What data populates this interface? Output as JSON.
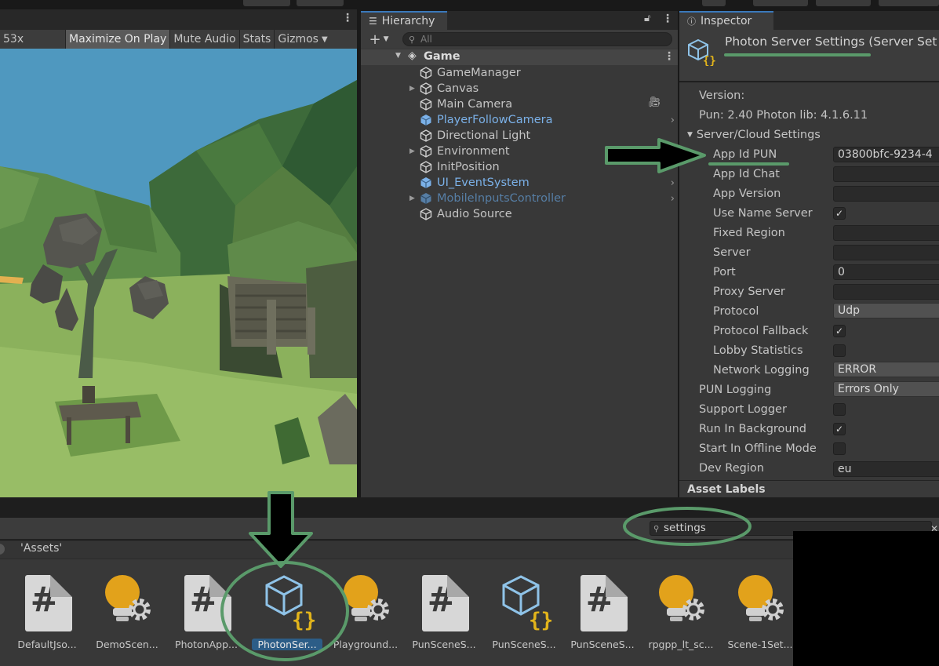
{
  "game_view": {
    "scale_label": "53x",
    "toolbar": [
      {
        "label": "Maximize On Play",
        "active": true
      },
      {
        "label": "Mute Audio",
        "active": false
      },
      {
        "label": "Stats",
        "active": false
      },
      {
        "label": "Gizmos",
        "active": false
      }
    ]
  },
  "hierarchy": {
    "tab_label": "Hierarchy",
    "search_placeholder": "All",
    "scene_name": "Game",
    "items": [
      {
        "label": "GameManager",
        "foldout": false,
        "prefab": "none"
      },
      {
        "label": "Canvas",
        "foldout": true,
        "prefab": "none"
      },
      {
        "label": "Main Camera",
        "foldout": false,
        "prefab": "none"
      },
      {
        "label": "PlayerFollowCamera",
        "foldout": false,
        "prefab": "prefab"
      },
      {
        "label": "Directional Light",
        "foldout": false,
        "prefab": "none"
      },
      {
        "label": "Environment",
        "foldout": true,
        "prefab": "none"
      },
      {
        "label": "InitPosition",
        "foldout": false,
        "prefab": "none"
      },
      {
        "label": "UI_EventSystem",
        "foldout": false,
        "prefab": "prefab"
      },
      {
        "label": "MobileInputsController",
        "foldout": true,
        "prefab": "prefab-disabled"
      },
      {
        "label": "Audio Source",
        "foldout": false,
        "prefab": "none"
      }
    ]
  },
  "inspector": {
    "tab_label": "Inspector",
    "title": "Photon Server Settings (Server Set",
    "version_label": "Version:",
    "version_value": "Pun: 2.40 Photon lib: 4.1.6.11",
    "section_label": "Server/Cloud Settings",
    "server_fields": [
      {
        "label": "App Id PUN",
        "type": "text",
        "value": "03800bfc-9234-4"
      },
      {
        "label": "App Id Chat",
        "type": "text",
        "value": ""
      },
      {
        "label": "App Version",
        "type": "text",
        "value": ""
      },
      {
        "label": "Use Name Server",
        "type": "check",
        "value": "✓"
      },
      {
        "label": "Fixed Region",
        "type": "text",
        "value": ""
      },
      {
        "label": "Server",
        "type": "text",
        "value": ""
      },
      {
        "label": "Port",
        "type": "text",
        "value": "0"
      },
      {
        "label": "Proxy Server",
        "type": "text",
        "value": ""
      },
      {
        "label": "Protocol",
        "type": "dropdown",
        "value": "Udp"
      },
      {
        "label": "Protocol Fallback",
        "type": "check",
        "value": "✓"
      },
      {
        "label": "Lobby Statistics",
        "type": "check",
        "value": ""
      },
      {
        "label": "Network Logging",
        "type": "dropdown",
        "value": "ERROR"
      }
    ],
    "general_fields": [
      {
        "label": "PUN Logging",
        "type": "dropdown",
        "value": "Errors Only"
      },
      {
        "label": "Support Logger",
        "type": "check",
        "value": ""
      },
      {
        "label": "Run In Background",
        "type": "check",
        "value": "✓"
      },
      {
        "label": "Start In Offline Mode",
        "type": "check",
        "value": ""
      },
      {
        "label": "Dev Region",
        "type": "text",
        "value": "eu"
      }
    ],
    "asset_labels": "Asset Labels"
  },
  "project": {
    "search_value": "settings",
    "breadcrumb": "'Assets'",
    "assets": [
      {
        "name": "DefaultJso...",
        "kind": "script",
        "selected": false
      },
      {
        "name": "DemoScen...",
        "kind": "lighting",
        "selected": false
      },
      {
        "name": "PhotonApp...",
        "kind": "script",
        "selected": false
      },
      {
        "name": "PhotonSer...",
        "kind": "scriptable",
        "selected": true
      },
      {
        "name": "Playground...",
        "kind": "lighting",
        "selected": false
      },
      {
        "name": "PunSceneS...",
        "kind": "script",
        "selected": false
      },
      {
        "name": "PunSceneS...",
        "kind": "scriptable",
        "selected": false
      },
      {
        "name": "PunSceneS...",
        "kind": "script",
        "selected": false
      },
      {
        "name": "rpgpp_lt_sc...",
        "kind": "lighting",
        "selected": false
      },
      {
        "name": "Scene-1Set...",
        "kind": "lighting",
        "selected": false
      }
    ]
  },
  "colors": {
    "annotation": "#5a9a6a",
    "prefab_text": "#7bb1e8",
    "selected_bg": "#2c5d87",
    "script_icon_bg": "#d7d7d7",
    "lighting_bulb": "#e2a21b"
  }
}
